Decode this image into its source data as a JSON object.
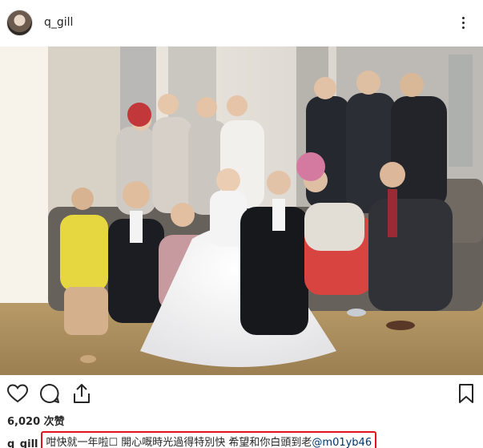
{
  "post": {
    "username": "q_gill",
    "likes_count": "6,020",
    "likes_label": "次赞",
    "caption_user": "q_gill",
    "caption_text": "咁快就一年啦☐ 開心嘅時光過得特別快 希望和你白頭到老",
    "caption_mention": "@m01yb46"
  },
  "icons": {
    "more": "more-options-icon",
    "like": "heart-icon",
    "comment": "comment-icon",
    "share": "share-icon",
    "save": "bookmark-icon"
  },
  "colors": {
    "highlight_border": "#e0141e",
    "mention": "#003569",
    "text": "#262626"
  }
}
